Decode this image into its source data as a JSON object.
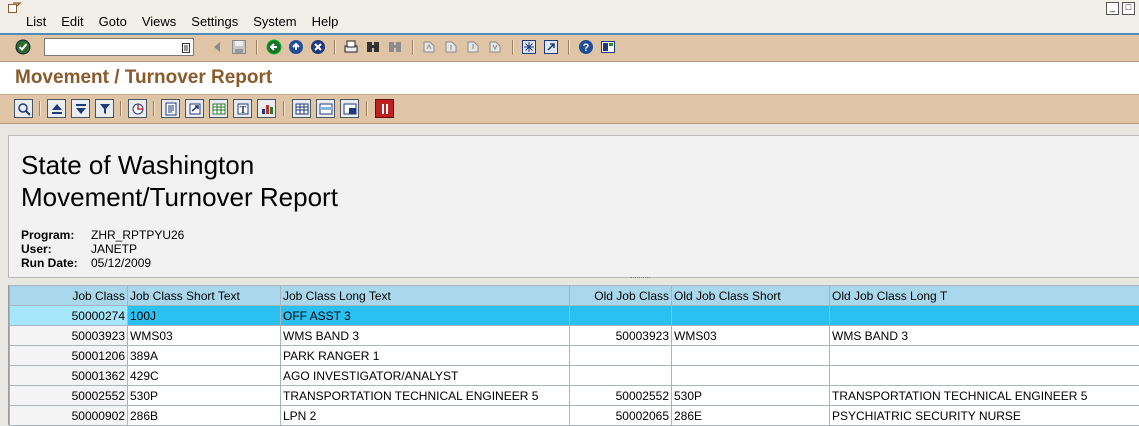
{
  "menubar": {
    "items": [
      "List",
      "Edit",
      "Goto",
      "Views",
      "Settings",
      "System",
      "Help"
    ]
  },
  "toolbar": {
    "command_value": "",
    "icons": [
      "enter-icon",
      "back-icon",
      "exit-icon",
      "cancel-icon",
      "print-icon",
      "find-icon",
      "find-next-icon",
      "first-page-icon",
      "previous-page-icon",
      "next-page-icon",
      "last-page-icon",
      "create-session-icon",
      "shortcut-icon",
      "help-icon",
      "layout-icon"
    ]
  },
  "title": "Movement / Turnover Report",
  "report": {
    "line1": "State of Washington",
    "line2": "Movement/Turnover Report",
    "program_label": "Program:",
    "program_value": "ZHR_RPTPYU26",
    "user_label": "User:",
    "user_value": "JANETP",
    "rundate_label": "Run Date:",
    "rundate_value": "05/12/2009"
  },
  "grid": {
    "columns": [
      "Job Class",
      "Job Class Short Text",
      "Job Class Long Text",
      "Old Job Class",
      "Old Job Class Short",
      "Old Job Class Long T"
    ],
    "rows": [
      {
        "job_class": "50000274",
        "short": "100J",
        "long": "OFF ASST 3",
        "old_class": "",
        "old_short": "",
        "old_long": ""
      },
      {
        "job_class": "50003923",
        "short": "WMS03",
        "long": "WMS BAND 3",
        "old_class": "50003923",
        "old_short": "WMS03",
        "old_long": "WMS BAND 3"
      },
      {
        "job_class": "50001206",
        "short": "389A",
        "long": "PARK RANGER 1",
        "old_class": "",
        "old_short": "",
        "old_long": ""
      },
      {
        "job_class": "50001362",
        "short": "429C",
        "long": "AGO INVESTIGATOR/ANALYST",
        "old_class": "",
        "old_short": "",
        "old_long": ""
      },
      {
        "job_class": "50002552",
        "short": "530P",
        "long": "TRANSPORTATION TECHNICAL ENGINEER 5",
        "old_class": "50002552",
        "old_short": "530P",
        "old_long": "TRANSPORTATION TECHNICAL ENGINEER 5"
      },
      {
        "job_class": "50000902",
        "short": "286B",
        "long": "LPN 2",
        "old_class": "50002065",
        "old_short": "286E",
        "old_long": "PSYCHIATRIC SECURITY NURSE"
      }
    ]
  }
}
